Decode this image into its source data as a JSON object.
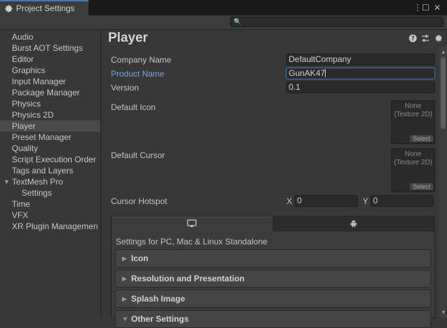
{
  "window": {
    "tab_title": "Project Settings"
  },
  "sidebar": {
    "items": [
      {
        "label": "Audio"
      },
      {
        "label": "Burst AOT Settings"
      },
      {
        "label": "Editor"
      },
      {
        "label": "Graphics"
      },
      {
        "label": "Input Manager"
      },
      {
        "label": "Package Manager"
      },
      {
        "label": "Physics"
      },
      {
        "label": "Physics 2D"
      },
      {
        "label": "Player"
      },
      {
        "label": "Preset Manager"
      },
      {
        "label": "Quality"
      },
      {
        "label": "Script Execution Order"
      },
      {
        "label": "Tags and Layers"
      },
      {
        "label": "TextMesh Pro"
      },
      {
        "label": "Settings"
      },
      {
        "label": "Time"
      },
      {
        "label": "VFX"
      },
      {
        "label": "XR Plugin Managemen"
      }
    ],
    "selected": "Player"
  },
  "main": {
    "title": "Player",
    "company_name_label": "Company Name",
    "company_name_value": "DefaultCompany",
    "product_name_label": "Product Name",
    "product_name_value": "GunAK47",
    "version_label": "Version",
    "version_value": "0.1",
    "default_icon_label": "Default Icon",
    "default_cursor_label": "Default Cursor",
    "texture_none": "None",
    "texture_type": "(Texture 2D)",
    "select_label": "Select",
    "cursor_hotspot_label": "Cursor Hotspot",
    "x_label": "X",
    "x_value": "0",
    "y_label": "Y",
    "y_value": "0"
  },
  "platform_panel": {
    "settings_label": "Settings for PC, Mac & Linux Standalone",
    "sections": [
      {
        "label": "Icon"
      },
      {
        "label": "Resolution and Presentation"
      },
      {
        "label": "Splash Image"
      },
      {
        "label": "Other Settings"
      }
    ]
  },
  "colors": {
    "accent": "#3a79bb",
    "active_label": "#7aa6da",
    "background": "#383838"
  }
}
